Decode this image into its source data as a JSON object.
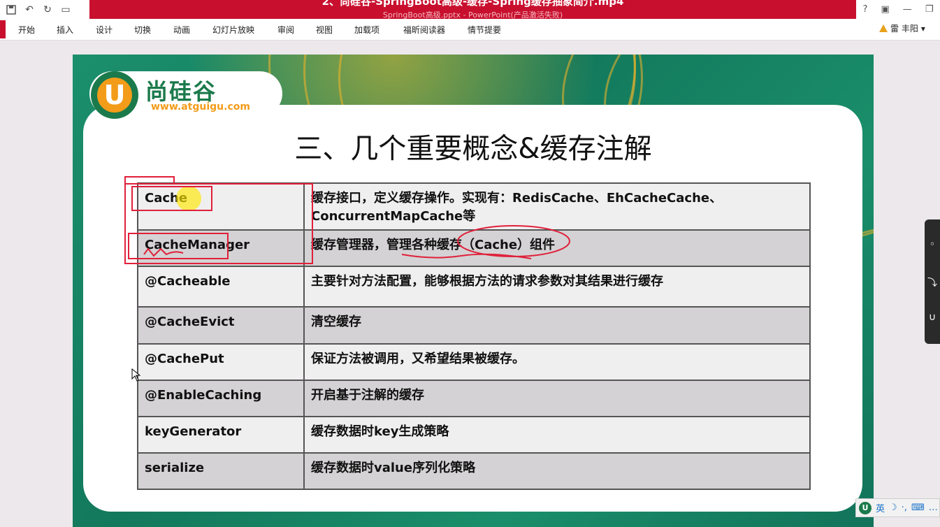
{
  "window": {
    "video_title": "2、尚硅谷-SpringBoot高级-缓存-Spring缓存抽象简介.mp4",
    "doc_title": "SpringBoot高级.pptx - PowerPoint(产品激活失败)"
  },
  "quick_access": [
    "save-icon",
    "undo-icon",
    "redo-icon",
    "from-start-icon"
  ],
  "ribbon": {
    "tabs": [
      "开始",
      "插入",
      "设计",
      "切换",
      "动画",
      "幻灯片放映",
      "审阅",
      "视图",
      "加载项",
      "福昕阅读器",
      "情节提要"
    ],
    "user": "雷 丰阳",
    "user_dropdown": "▾"
  },
  "slide": {
    "logo_text": "尚硅谷",
    "logo_url": "www.atguigu.com",
    "logo_letter": "U",
    "title": "三、几个重要概念&缓存注解",
    "table": [
      {
        "name": "Cache",
        "desc": "缓存接口，定义缓存操作。实现有：RedisCache、EhCacheCache、ConcurrentMapCache等"
      },
      {
        "name": "CacheManager",
        "desc": "缓存管理器，管理各种缓存（Cache）组件"
      },
      {
        "name": "@Cacheable",
        "desc": "主要针对方法配置，能够根据方法的请求参数对其结果进行缓存"
      },
      {
        "name": "@CacheEvict",
        "desc": "清空缓存"
      },
      {
        "name": "@CachePut",
        "desc": "保证方法被调用，又希望结果被缓存。"
      },
      {
        "name": "@EnableCaching",
        "desc": "开启基于注解的缓存"
      },
      {
        "name": "keyGenerator",
        "desc": "缓存数据时key生成策略"
      },
      {
        "name": "serialize",
        "desc": "缓存数据时value序列化策略"
      }
    ]
  },
  "ime": {
    "lang": "英"
  },
  "colors": {
    "title_bar": "#c8102e",
    "slide_green": "#1b8f6c",
    "brand_orange": "#f39c1a",
    "annotation_red": "#e0203a"
  }
}
